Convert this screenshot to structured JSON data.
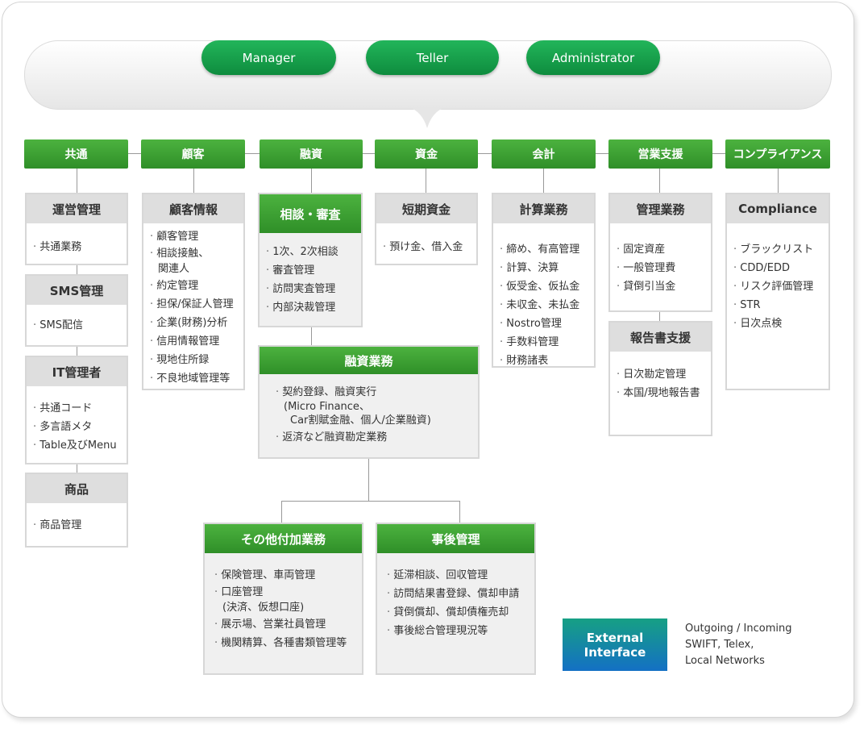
{
  "roles": [
    "Manager",
    "Teller",
    "Administrator"
  ],
  "categories": [
    "共通",
    "顧客",
    "融資",
    "資金",
    "会計",
    "営業支援",
    "コンプライアンス"
  ],
  "common": {
    "operations": {
      "title": "運営管理",
      "items": [
        "共通業務"
      ]
    },
    "sms": {
      "title": "SMS管理",
      "items": [
        "SMS配信"
      ]
    },
    "it": {
      "title": "IT管理者",
      "items": [
        "共通コード",
        "多言語メタ",
        "Table及びMenu"
      ]
    },
    "product": {
      "title": "商品",
      "items": [
        "商品管理"
      ]
    }
  },
  "customer": {
    "title": "顧客情報",
    "items": [
      "顧客管理",
      "相談接触、",
      "関連人",
      "約定管理",
      "担保/保証人管理",
      "企業(財務)分析",
      "信用情報管理",
      "現地住所録",
      "不良地域管理等"
    ]
  },
  "loan": {
    "consult": {
      "title": "相談・審査",
      "items": [
        "1次、2次相談",
        "審査管理",
        "訪問実査管理",
        "内部決裁管理"
      ]
    },
    "business": {
      "title": "融資業務",
      "items": [
        "契約登録、融資実行",
        "(Micro Finance、",
        "Car割賦金融、個人/企業融資)",
        "返済など融資勘定業務"
      ]
    },
    "other": {
      "title": "その他付加業務",
      "items": [
        "保険管理、車両管理",
        "口座管理",
        "(決済、仮想口座)",
        "展示場、営業社員管理",
        "機関精算、各種書類管理等"
      ]
    },
    "after": {
      "title": "事後管理",
      "items": [
        "延滞相談、回収管理",
        "訪問結果書登録、償却申請",
        "貸倒償却、償却債権売却",
        "事後総合管理現況等"
      ]
    }
  },
  "funds": {
    "title": "短期資金",
    "items": [
      "預け金、借入金"
    ]
  },
  "accounting": {
    "title": "計算業務",
    "items": [
      "締め、有高管理",
      "計算、決算",
      "仮受金、仮払金",
      "未収金、未払金",
      "Nostro管理",
      "手数料管理",
      "財務諸表"
    ]
  },
  "sales": {
    "mgmt": {
      "title": "管理業務",
      "items": [
        "固定資産",
        " 一般管理費",
        "貸倒引当金"
      ]
    },
    "report": {
      "title": "報告書支援",
      "items": [
        "日次勘定管理",
        "本国/現地報告書"
      ]
    }
  },
  "compliance": {
    "title": "Compliance",
    "items": [
      "ブラックリスト",
      "CDD/EDD",
      "リスク評価管理",
      "STR",
      "日次点検"
    ]
  },
  "external": {
    "label_1": "External",
    "label_2": "Interface",
    "notes": [
      "Outgoing / Incoming",
      "SWIFT, Telex,",
      "Local Networks"
    ]
  }
}
